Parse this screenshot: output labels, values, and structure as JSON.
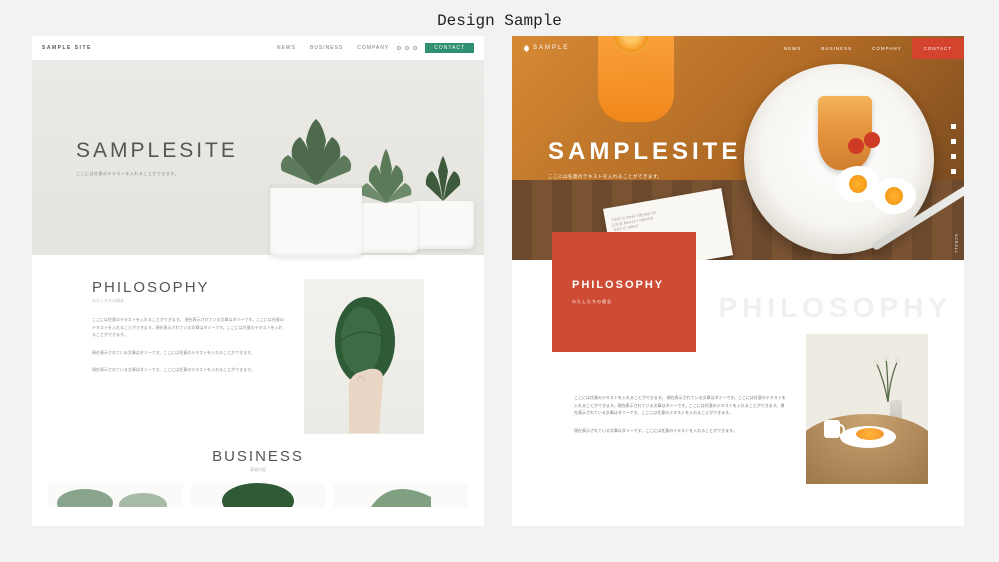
{
  "page": {
    "title": "Design Sample"
  },
  "left": {
    "header": {
      "logo": "SAMPLE SITE",
      "nav": [
        "NEWS",
        "BUSINESS",
        "COMPANY"
      ],
      "contact": "CONTACT"
    },
    "hero": {
      "title": "SAMPLESITE",
      "subtitle": "ここには任意のテキストを入れることができます。"
    },
    "philosophy": {
      "title": "PHILOSOPHY",
      "subtitle": "わたしたちの理念",
      "p1": "ここには任意のテキストを入れることができます。\n現在表示されている文章はダミーです。ここには任意のテキストを入れることができます。現在表示されている文章はダミーです。ここには任意のテキストを入れることができます。",
      "p2": "現在表示されている文章はダミーです。ここには任意のテキストを入れることができます。",
      "p3": "現在表示されている文章はダミーです。ここには任意のテキストを入れることができます。"
    },
    "business": {
      "title": "BUSINESS",
      "subtitle": "事業内容"
    }
  },
  "right": {
    "header": {
      "logo": "SAMPLE",
      "nav": [
        "NEWS",
        "BUSINESS",
        "COMPANY"
      ],
      "contact": "CONTACT"
    },
    "hero": {
      "title": "SAMPLESITE",
      "subtitle": "ここには任意のテキストを入れることができます。",
      "scroll": "SCROLL",
      "menu_lines": [
        "THIS IS WHAT BEING IN",
        "LOVE REALLY MEANS",
        "THIS IS WHAT"
      ]
    },
    "philosophy": {
      "title": "PHILOSOPHY",
      "subtitle": "わたしたちの理念",
      "bg": "PHILOSOPHY",
      "p1": "ここには任意のテキストを入れることができます。\n現在表示されている文章はダミーです。ここには任意のテキストを入れることができます。現在表示されている文章はダミーです。ここには任意のテキストを入れることができます。現在表示されている文章はダミーです。ここには任意のテキストを入れることができます。",
      "p2": "現在表示されている文章はダミーです。ここには任意のテキストを入れることができます。"
    }
  }
}
